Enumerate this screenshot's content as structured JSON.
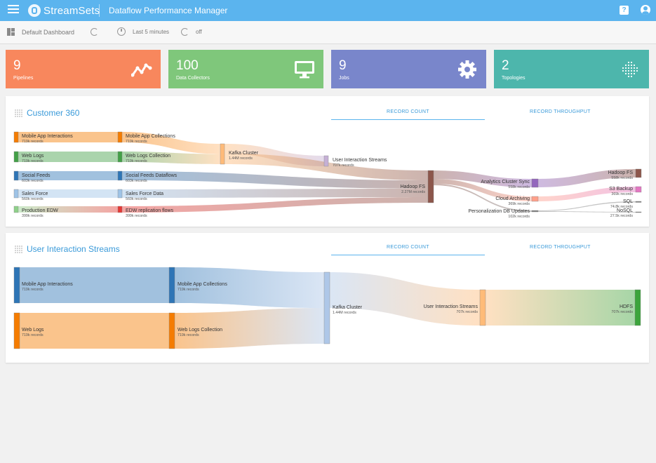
{
  "topbar": {
    "brand": "StreamSets",
    "title": "Dataflow Performance Manager"
  },
  "toolbar": {
    "dashboard": "Default Dashboard",
    "time_range": "Last 5 minutes",
    "auto_refresh": "off"
  },
  "tiles": [
    {
      "value": "9",
      "label": "Pipelines",
      "color": "#f8875d",
      "icon": "line-chart-icon"
    },
    {
      "value": "100",
      "label": "Data Collectors",
      "color": "#7fc77b",
      "icon": "monitor-icon"
    },
    {
      "value": "9",
      "label": "Jobs",
      "color": "#7986cb",
      "icon": "gear-icon"
    },
    {
      "value": "2",
      "label": "Topologies",
      "color": "#4db6ac",
      "icon": "dots-grid-icon"
    }
  ],
  "cards": [
    {
      "title": "Customer 360",
      "tab_count": "RECORD COUNT",
      "tab_throughput": "RECORD THROUGHPUT"
    },
    {
      "title": "User Interaction Streams",
      "tab_count": "RECORD COUNT",
      "tab_throughput": "RECORD THROUGHPUT"
    }
  ],
  "sankey1": {
    "nodes": [
      {
        "name": "Mobile App Interactions",
        "sub": "719k records",
        "color": "#f57c00"
      },
      {
        "name": "Web Logs",
        "sub": "719k records",
        "color": "#43a047"
      },
      {
        "name": "Social Feeds",
        "sub": "603k records",
        "color": "#2e75b6"
      },
      {
        "name": "Sales Force",
        "sub": "560k records",
        "color": "#9ec3e6"
      },
      {
        "name": "Production EDW",
        "sub": "399k records",
        "color": "#8fd18a"
      },
      {
        "name": "Mobile App Collections",
        "sub": "719k records",
        "color": "#f57c00"
      },
      {
        "name": "Web Logs Collection",
        "sub": "719k records",
        "color": "#43a047"
      },
      {
        "name": "Social Feeds Dataflows",
        "sub": "603k records",
        "color": "#2e75b6"
      },
      {
        "name": "Sales Force Data",
        "sub": "560k records",
        "color": "#9ec3e6"
      },
      {
        "name": "EDW replication flows",
        "sub": "399k records",
        "color": "#e53935"
      },
      {
        "name": "Kafka Cluster",
        "sub": "1.44M records",
        "color": "#ffbb78"
      },
      {
        "name": "User Interaction Streams",
        "sub": "707k records",
        "color": "#c5b0d5"
      },
      {
        "name": "Hadoop FS",
        "sub": "2.27M records",
        "color": "#8c564b"
      },
      {
        "name": "Analytics Cluster Sync",
        "sub": "558k records",
        "color": "#9467bd"
      },
      {
        "name": "Cloud Archiving",
        "sub": "369k records",
        "color": "#ffa08a"
      },
      {
        "name": "Personalization DB Updates",
        "sub": "102k records",
        "color": "#7f7f7f"
      },
      {
        "name": "Hadoop FS",
        "sub": "558k records",
        "color": "#8c564b"
      },
      {
        "name": "S3 Backup",
        "sub": "369k records",
        "color": "#e377c2"
      },
      {
        "name": "SQL",
        "sub": "74.8k records",
        "color": "#7f7f7f"
      },
      {
        "name": "NoSQL",
        "sub": "27.5k records",
        "color": "#7f7f7f"
      }
    ]
  },
  "sankey2": {
    "nodes": [
      {
        "name": "Mobile App Interactions",
        "sub": "719k records",
        "color": "#2e75b6"
      },
      {
        "name": "Web Logs",
        "sub": "719k records",
        "color": "#f57c00"
      },
      {
        "name": "Mobile App Collections",
        "sub": "719k records",
        "color": "#2e75b6"
      },
      {
        "name": "Web Logs Collection",
        "sub": "719k records",
        "color": "#f57c00"
      },
      {
        "name": "Kafka Cluster",
        "sub": "1.44M records",
        "color": "#aec7e8"
      },
      {
        "name": "User Interaction Streams",
        "sub": "707k records",
        "color": "#ffbb78"
      },
      {
        "name": "HDFS",
        "sub": "707k records",
        "color": "#3ca43c"
      }
    ]
  }
}
